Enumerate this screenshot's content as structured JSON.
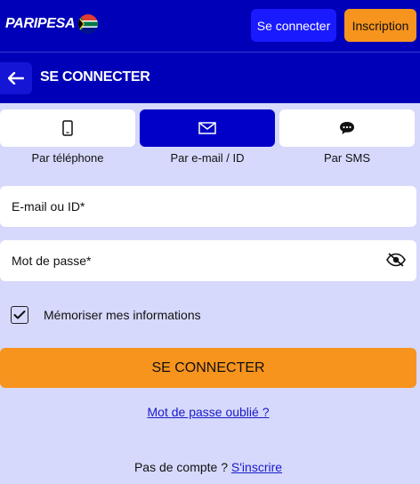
{
  "header": {
    "logo_text": "PARIPESA",
    "login_label": "Se connecter",
    "register_label": "Inscription"
  },
  "subheader": {
    "title": "SE CONNECTER"
  },
  "tabs": [
    {
      "label": "Par téléphone",
      "icon": "phone-icon",
      "active": false
    },
    {
      "label": "Par e-mail / ID",
      "icon": "envelope-icon",
      "active": true
    },
    {
      "label": "Par SMS",
      "icon": "chat-bubble-icon",
      "active": false
    }
  ],
  "form": {
    "email_placeholder": "E-mail ou ID*",
    "password_placeholder": "Mot de passe*",
    "remember_label": "Mémoriser mes informations",
    "remember_checked": true,
    "submit_label": "SE CONNECTER",
    "forgot_label": "Mot de passe oublié ?",
    "no_account_label": "Pas de compte ?",
    "signup_label": "S'inscrire"
  },
  "colors": {
    "header_bg": "#0000b8",
    "accent_orange": "#f7941d",
    "page_bg": "#d6d9fb",
    "active_tab": "#0000c8",
    "link": "#1a1acc"
  }
}
